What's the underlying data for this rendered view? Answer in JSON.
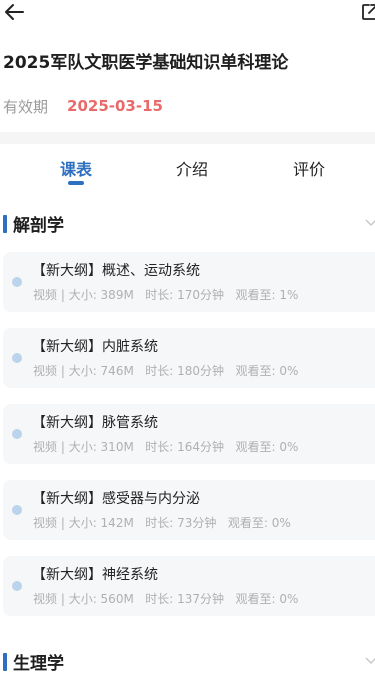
{
  "course": {
    "title": "2025军队文职医学基础知识单科理论",
    "validity_label": "有效期",
    "validity_date": "2025-03-15"
  },
  "tabs": [
    "课表",
    "介绍",
    "评价"
  ],
  "sections": [
    {
      "title": "解剖学",
      "lessons": [
        {
          "title": "【新大纲】概述、运动系统",
          "type": "视频",
          "size": "大小: 389M",
          "duration": "时长: 170分钟",
          "watched": "观看至: 1%"
        },
        {
          "title": "【新大纲】内脏系统",
          "type": "视频",
          "size": "大小: 746M",
          "duration": "时长: 180分钟",
          "watched": "观看至: 0%"
        },
        {
          "title": "【新大纲】脉管系统",
          "type": "视频",
          "size": "大小: 310M",
          "duration": "时长: 164分钟",
          "watched": "观看至: 0%"
        },
        {
          "title": "【新大纲】感受器与内分泌",
          "type": "视频",
          "size": "大小: 142M",
          "duration": "时长: 73分钟",
          "watched": "观看至: 0%"
        },
        {
          "title": "【新大纲】神经系统",
          "type": "视频",
          "size": "大小: 560M",
          "duration": "时长: 137分钟",
          "watched": "观看至: 0%"
        }
      ]
    },
    {
      "title": "生理学",
      "lessons": []
    }
  ],
  "meta_separator": " | ",
  "icons": {
    "back": "arrow-left-icon",
    "share": "share-icon",
    "chevron": "chevron-down-icon"
  },
  "colors": {
    "accent": "#2f6fbf",
    "date": "#e86a6a",
    "dot": "#bcd3ec"
  }
}
